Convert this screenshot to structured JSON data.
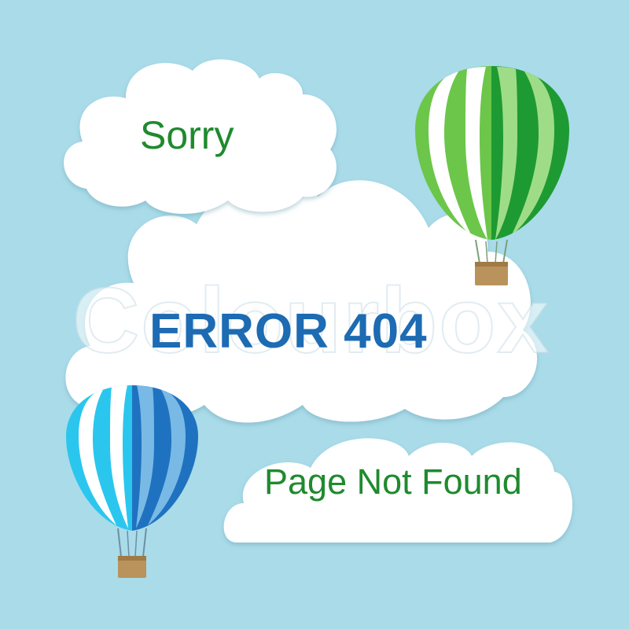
{
  "texts": {
    "sorry": "Sorry",
    "error": "ERROR 404",
    "not_found": "Page Not Found",
    "watermark": "Colourbox"
  },
  "colors": {
    "sky": "#a9dbe9",
    "cloud": "#ffffff",
    "green_text": "#1f8a2e",
    "blue_text": "#1c6bb3",
    "green_balloon_light": "#6cc64a",
    "green_balloon_dark": "#1e9a32",
    "blue_balloon_light": "#2bc6ee",
    "blue_balloon_dark": "#1f72c0",
    "basket": "#b9935b"
  },
  "icons": [
    "green-hot-air-balloon-icon",
    "blue-hot-air-balloon-icon",
    "cloud-icon"
  ]
}
